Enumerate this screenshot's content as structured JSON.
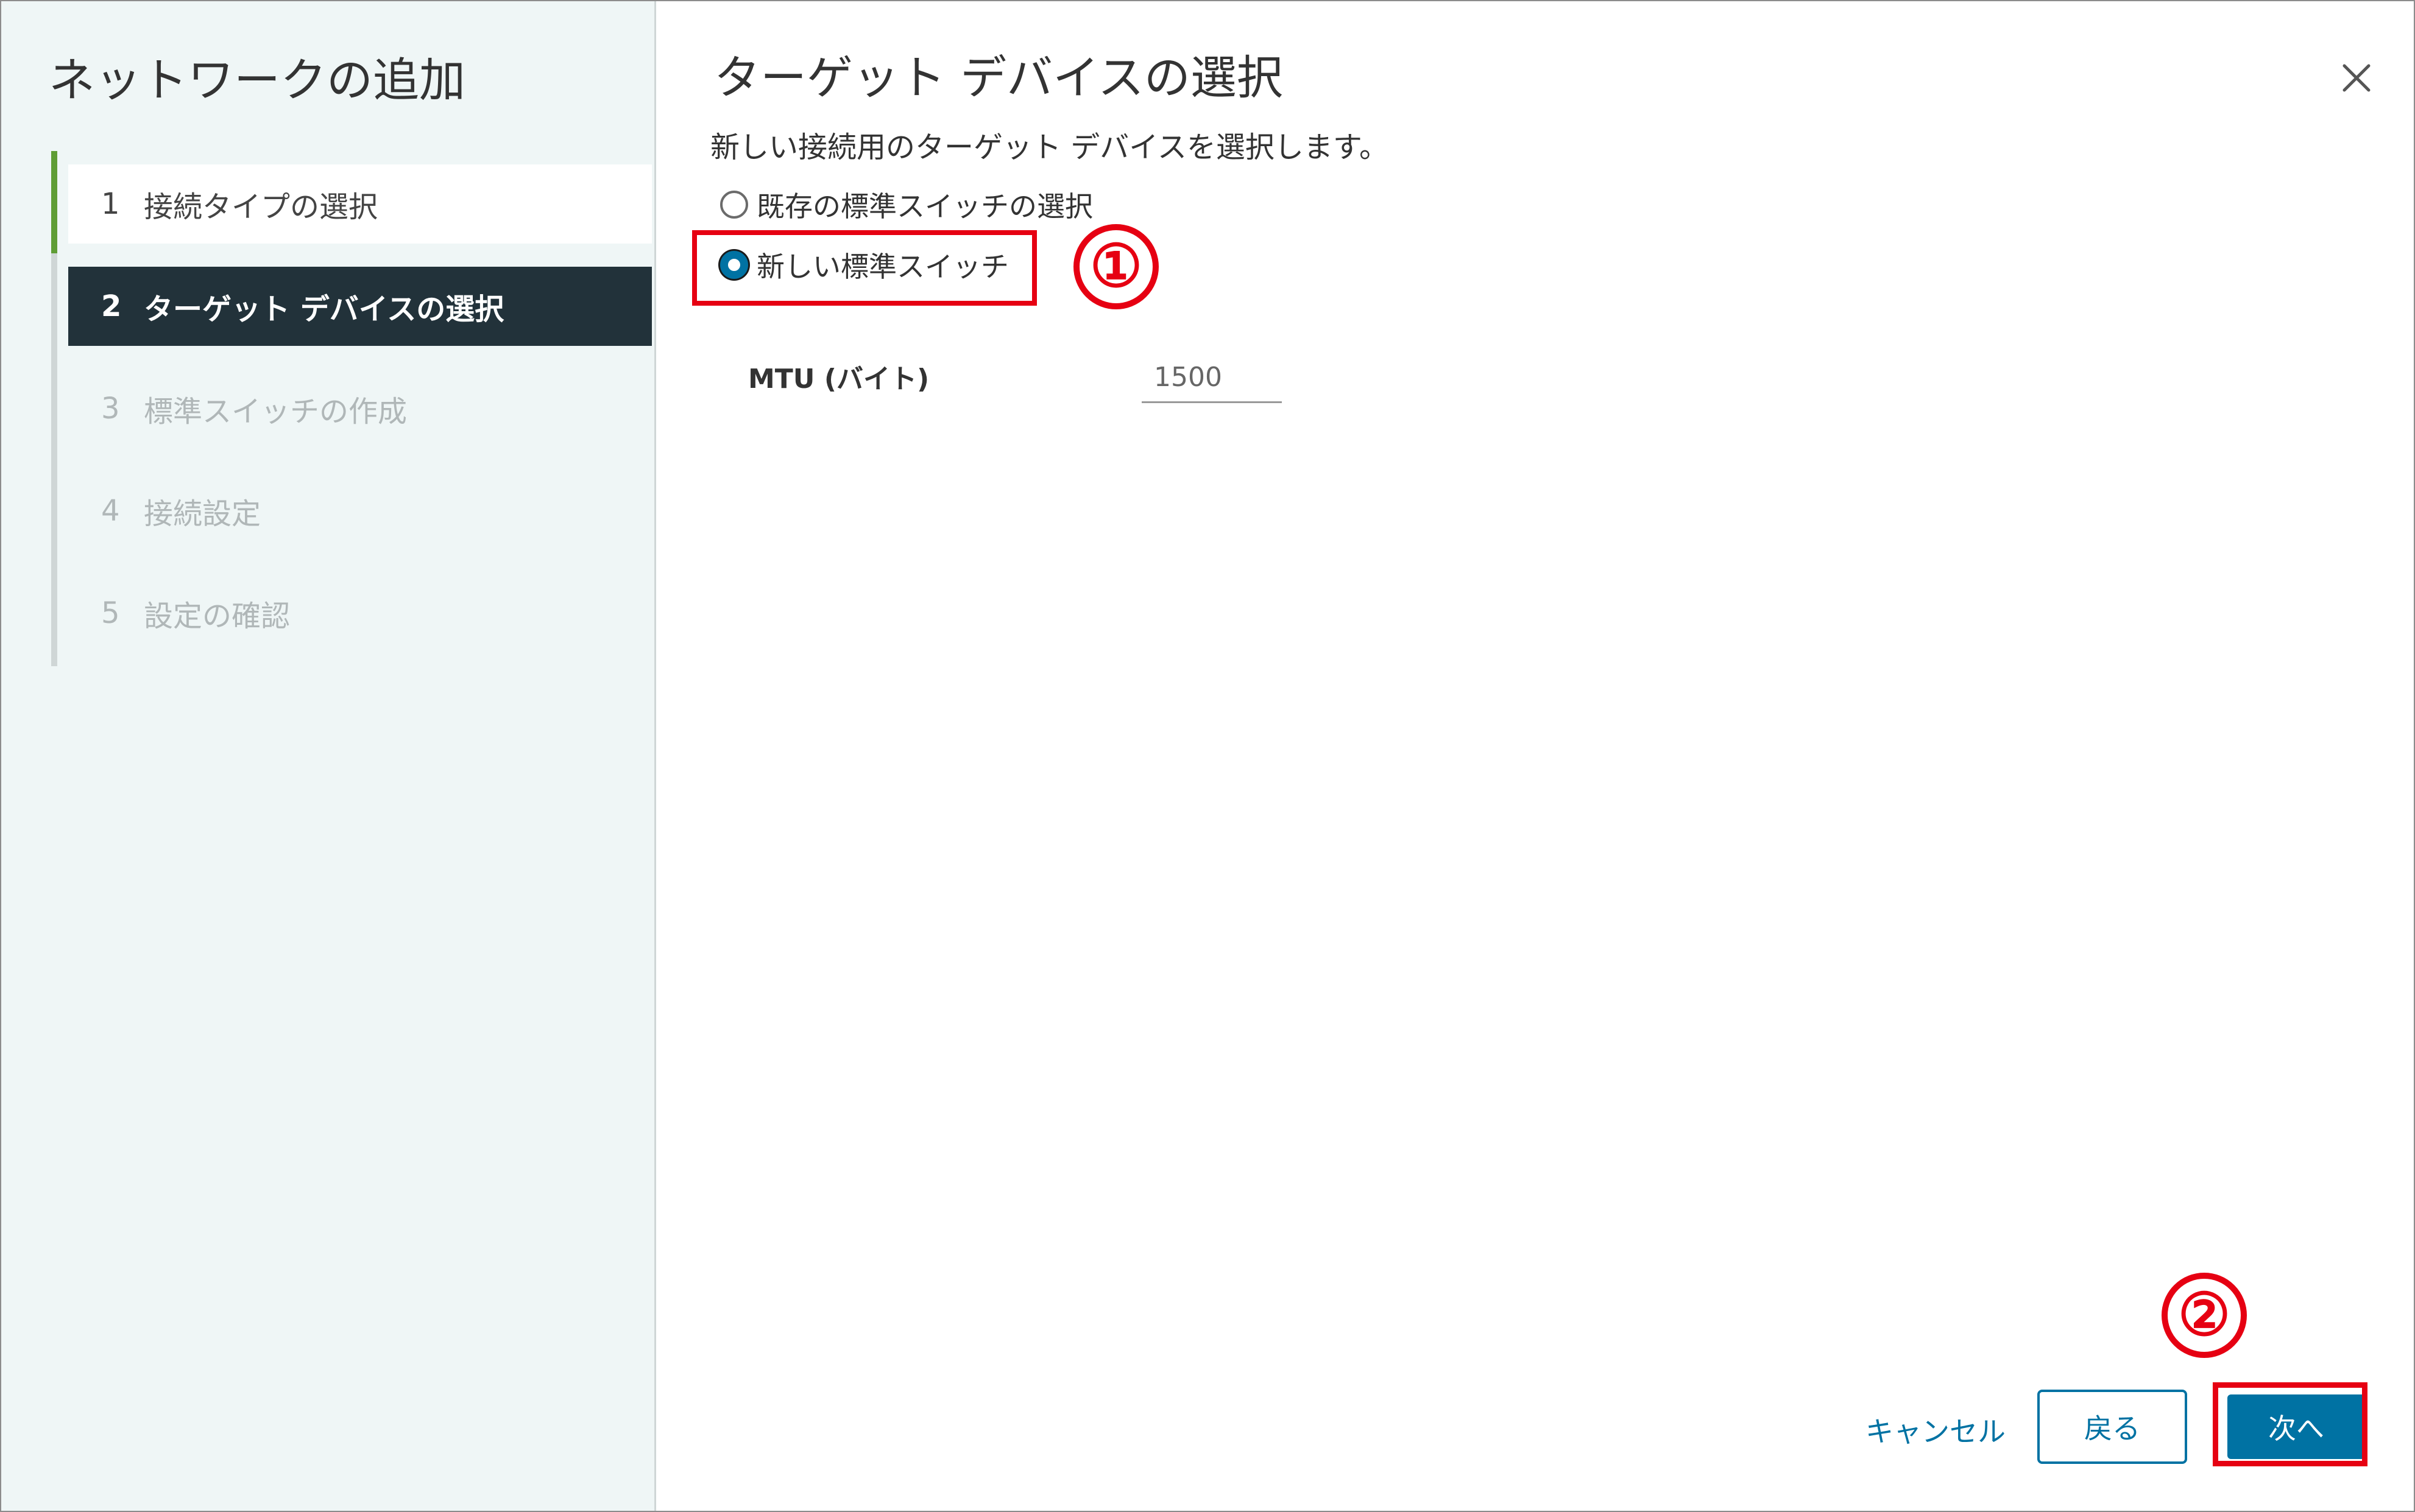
{
  "sidebar": {
    "title": "ネットワークの追加",
    "steps": [
      {
        "number": "1",
        "label": "接続タイプの選択",
        "state": "completed"
      },
      {
        "number": "2",
        "label": "ターゲット デバイスの選択",
        "state": "active"
      },
      {
        "number": "3",
        "label": "標準スイッチの作成",
        "state": "disabled"
      },
      {
        "number": "4",
        "label": "接続設定",
        "state": "disabled"
      },
      {
        "number": "5",
        "label": "設定の確認",
        "state": "disabled"
      }
    ]
  },
  "main": {
    "title": "ターゲット デバイスの選択",
    "description": "新しい接続用のターゲット デバイスを選択します。",
    "options": [
      {
        "label": "既存の標準スイッチの選択",
        "selected": false
      },
      {
        "label": "新しい標準スイッチ",
        "selected": true
      }
    ],
    "mtu": {
      "label": "MTU (バイト)",
      "value": "1500"
    }
  },
  "footer": {
    "cancel_label": "キャンセル",
    "back_label": "戻る",
    "next_label": "次へ"
  },
  "annotations": {
    "marker_1": "①",
    "marker_2": "②"
  },
  "icons": {
    "close": "close-icon"
  },
  "colors": {
    "accent": "#0072a3",
    "active_step_bg": "#22323a",
    "progress_green": "#5f9d35",
    "annotation_red": "#e60012",
    "sidebar_bg": "#eff6f6"
  }
}
